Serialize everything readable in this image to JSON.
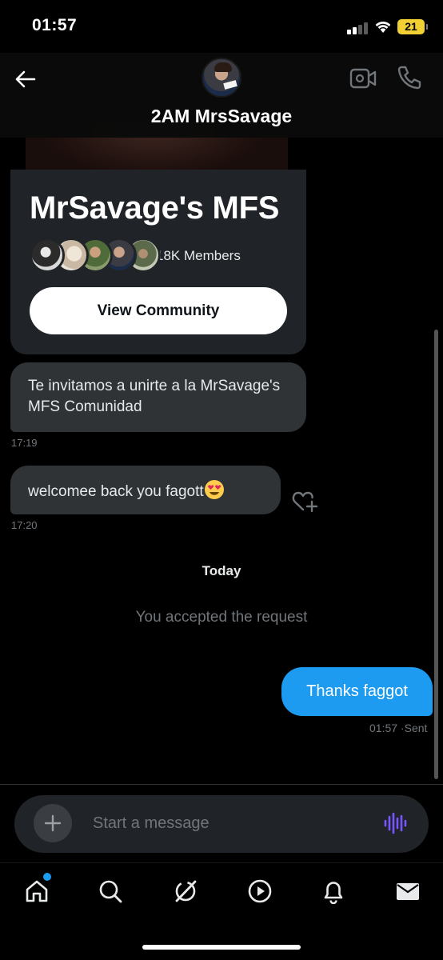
{
  "status_bar": {
    "time": "01:57",
    "battery": "21"
  },
  "header": {
    "contact_name": "2AM MrsSavage"
  },
  "community_card": {
    "title": "MrSavage's MFS",
    "members": "18K Members",
    "button_label": "View Community"
  },
  "messages": [
    {
      "text": "Te invitamos a unirte a la MrSavage's MFS Comunidad",
      "time": "17:19"
    },
    {
      "text": "welcomee back you fagott",
      "time": "17:20",
      "emoji": "heart-eyes"
    }
  ],
  "day_label": "Today",
  "system_message": "You accepted the request",
  "sent_message": {
    "text": "Thanks faggot",
    "time": "01:57",
    "status": "Sent"
  },
  "composer": {
    "placeholder": "Start a message"
  },
  "colors": {
    "accent": "#1d9bf0",
    "bubble_in": "#2f3336",
    "voice": "#7856ff",
    "battery": "#f2cf33"
  },
  "bottom_nav": [
    "home-icon",
    "search-icon",
    "grok-icon",
    "video-icon",
    "bell-icon",
    "mail-icon"
  ]
}
